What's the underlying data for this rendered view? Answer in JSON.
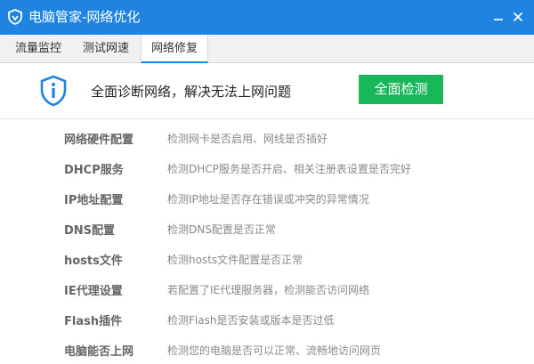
{
  "window": {
    "title": "电脑管家-网络优化",
    "icon": "qq-pc-manager-shield-icon",
    "accent_color": "#1f83e0"
  },
  "tabs": [
    {
      "label": "流量监控",
      "active": false
    },
    {
      "label": "测试网速",
      "active": false
    },
    {
      "label": "网络修复",
      "active": true
    }
  ],
  "header": {
    "icon": "info-shield-icon",
    "headline": "全面诊断网络，解决无法上网问题",
    "scan_button": "全面检测",
    "scan_button_color": "#19b65a"
  },
  "checks": [
    {
      "name": "网络硬件配置",
      "desc": "检测网卡是否启用、网线是否插好"
    },
    {
      "name": "DHCP服务",
      "desc": "检测DHCP服务是否开启、相关注册表设置是否完好"
    },
    {
      "name": "IP地址配置",
      "desc": "检测IP地址是否存在错误或冲突的异常情况"
    },
    {
      "name": "DNS配置",
      "desc": "检测DNS配置是否正常"
    },
    {
      "name": "hosts文件",
      "desc": "检测hosts文件配置是否正常"
    },
    {
      "name": "IE代理设置",
      "desc": "若配置了IE代理服务器，检测能否访问网络"
    },
    {
      "name": "Flash插件",
      "desc": "检测Flash是否安装或版本是否过低"
    },
    {
      "name": "电脑能否上网",
      "desc": "检测您的电脑是否可以正常、流畅地访问网页"
    }
  ]
}
